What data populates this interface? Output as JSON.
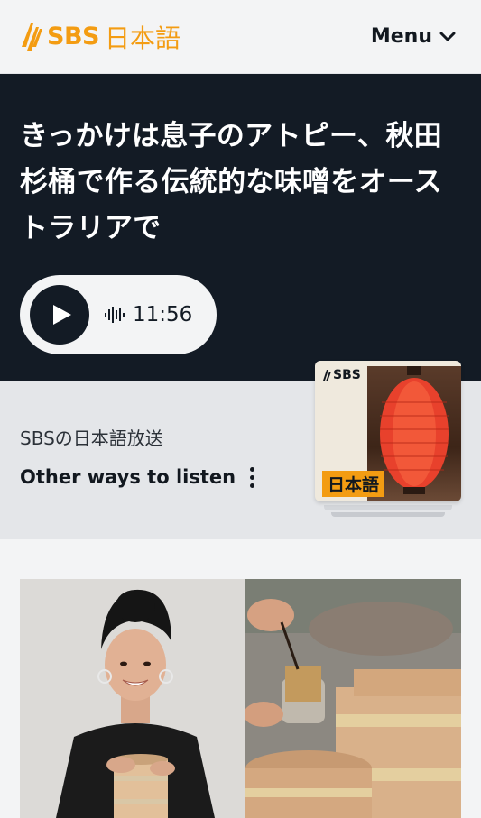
{
  "header": {
    "logo_brand": "SBS",
    "logo_language": "日本語",
    "menu_label": "Menu"
  },
  "hero": {
    "title": "きっかけは息子のアトピー、秋田杉桶で作る伝統的な味噌をオーストラリアで",
    "duration": "11:56"
  },
  "podcast": {
    "name": "SBSの日本語放送",
    "other_ways_label": "Other ways to listen",
    "cover_brand": "SBS",
    "cover_tag": "日本語"
  },
  "colors": {
    "brand_orange": "#f39c12",
    "hero_bg": "#131b25",
    "lantern_red": "#e8412c"
  },
  "icons": {
    "menu": "chevron-down-icon",
    "play": "play-icon",
    "audio": "waveform-icon",
    "more": "vertical-dots-icon"
  }
}
